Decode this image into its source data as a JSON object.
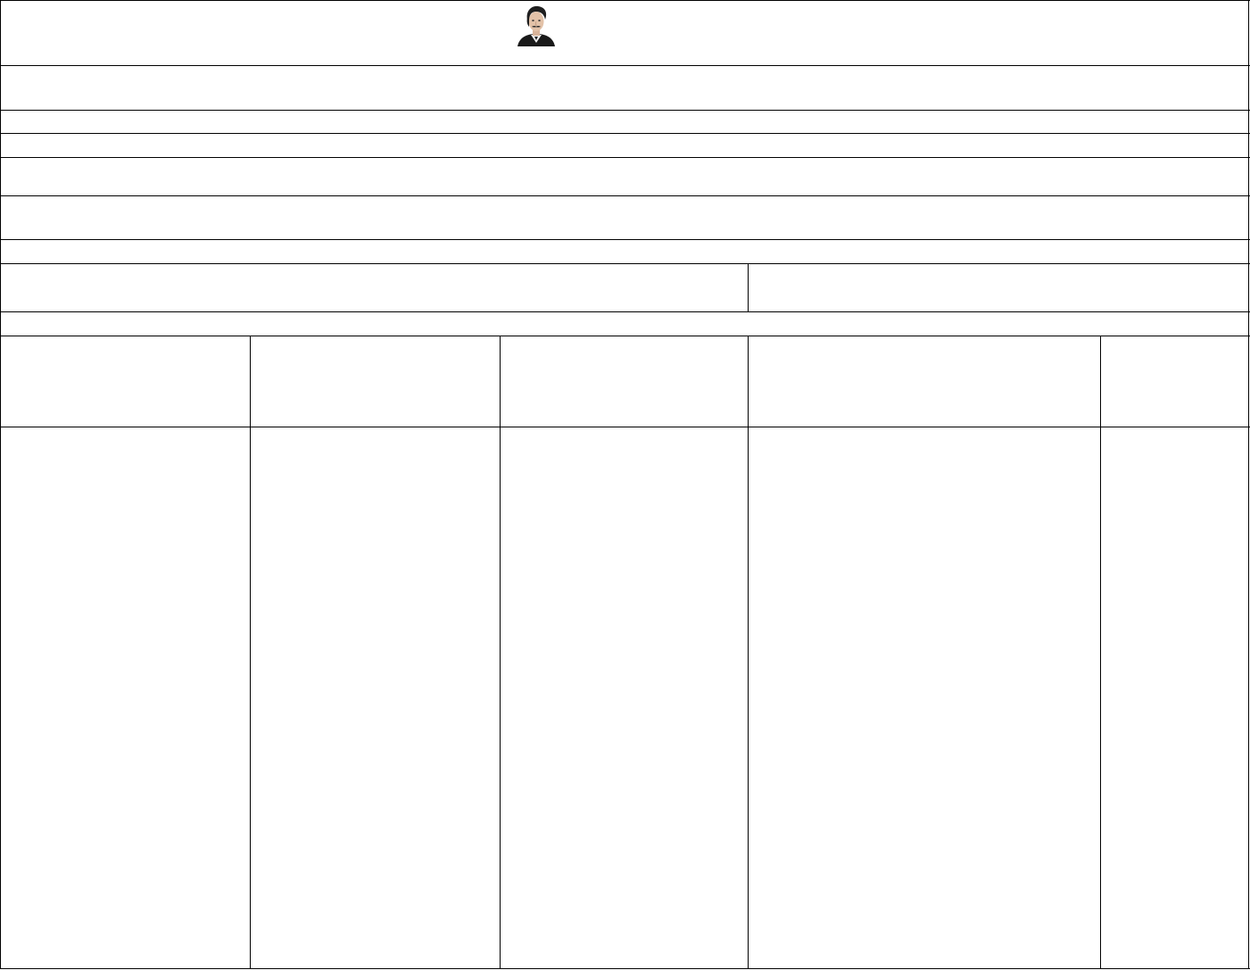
{
  "document": {
    "header": {
      "logo": "portrait-logo"
    },
    "rows": {
      "row_1": "",
      "row_2": "",
      "row_3": "",
      "row_4": "",
      "row_5": "",
      "row_6": "",
      "row_7_left": "",
      "row_7_right": "",
      "row_8": ""
    },
    "table": {
      "columns": [
        "",
        "",
        "",
        "",
        ""
      ],
      "cells": [
        [
          "",
          "",
          "",
          "",
          ""
        ]
      ]
    }
  }
}
